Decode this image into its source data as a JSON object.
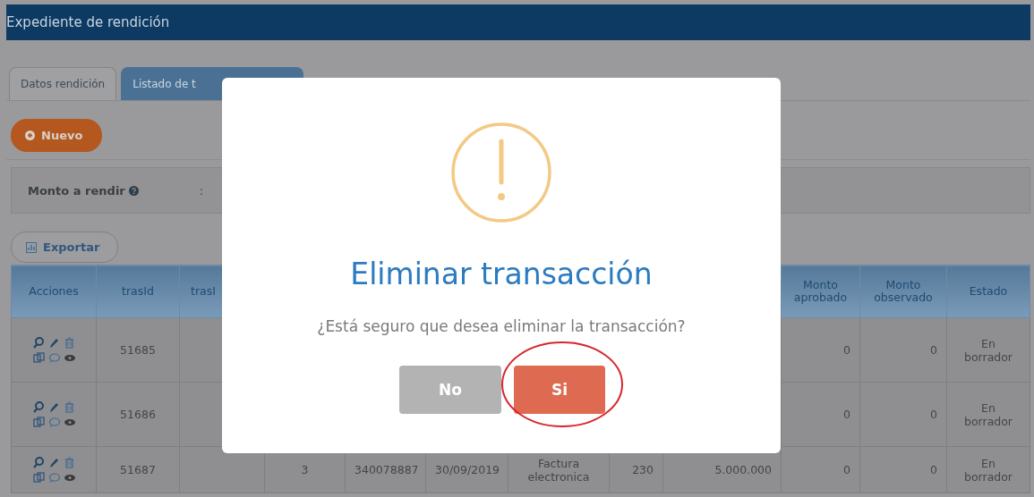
{
  "header": {
    "title": "Expediente de rendición"
  },
  "tabs": [
    {
      "label": "Datos rendición",
      "selected": false
    },
    {
      "label": "Listado de t",
      "selected": true
    }
  ],
  "new_button": {
    "label": "Nuevo"
  },
  "amount_panel": {
    "label": "Monto a rendir",
    "separator": ":"
  },
  "export_button": {
    "label": "Exportar"
  },
  "table": {
    "columns": [
      {
        "label": "Acciones"
      },
      {
        "label": "trasId"
      },
      {
        "label": "trasI"
      },
      {},
      {},
      {},
      {},
      {},
      {},
      {
        "label": "Monto aprobado"
      },
      {
        "label": "Monto observado"
      },
      {
        "label": "Estado"
      }
    ],
    "rows": [
      {
        "cells": [
          null,
          "51685",
          null,
          null,
          null,
          null,
          null,
          null,
          null,
          "0",
          "0",
          "En borrador"
        ]
      },
      {
        "cells": [
          null,
          "51686",
          null,
          null,
          null,
          null,
          null,
          null,
          null,
          "0",
          "0",
          "En borrador"
        ]
      },
      {
        "cells": [
          null,
          "51687",
          null,
          "3",
          "340078887",
          "30/09/2019",
          "Factura electronica",
          "230",
          "5.000.000",
          "0",
          "0",
          "En borrador"
        ]
      }
    ]
  },
  "dialog": {
    "kind": "warning",
    "title": "Eliminar transacción",
    "message": "¿Está seguro que desea eliminar la transacción?",
    "buttons": [
      {
        "label": "No",
        "kind": "cancel"
      },
      {
        "label": "Si",
        "kind": "confirm",
        "highlighted": true
      }
    ]
  }
}
